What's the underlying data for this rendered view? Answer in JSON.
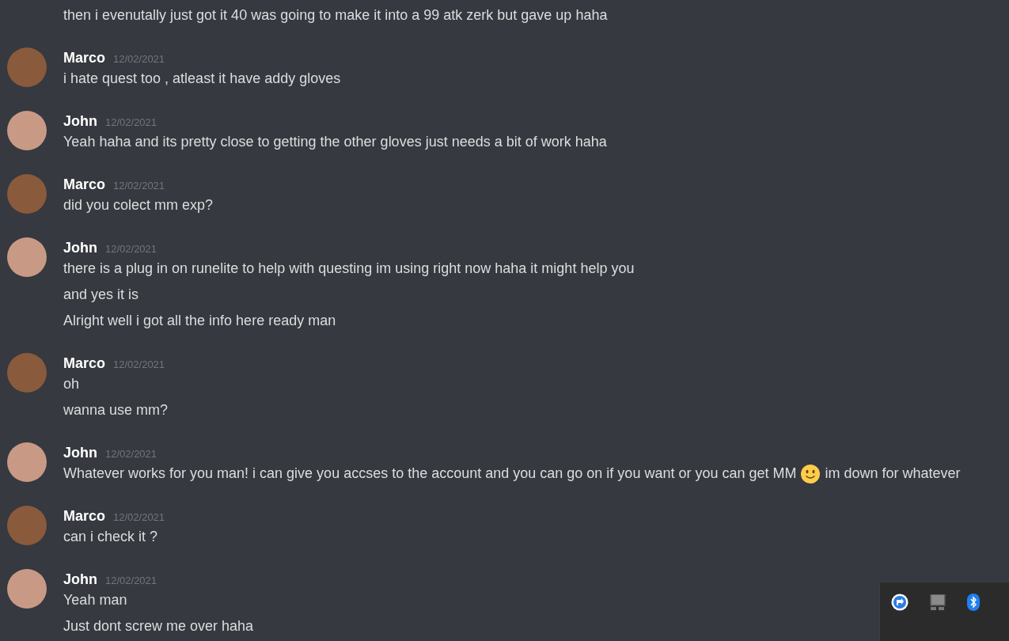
{
  "messages": [
    {
      "lines": [
        {
          "text": "then i evenutally just got it 40 was going to make it into a 99 atk zerk but gave up haha"
        }
      ]
    },
    {
      "author": "Marco",
      "color": "#8a5a3c",
      "timestamp": "12/02/2021",
      "lines": [
        {
          "text": "i hate quest too , atleast it have addy gloves"
        }
      ]
    },
    {
      "author": "John",
      "color": "#c89a86",
      "timestamp": "12/02/2021",
      "lines": [
        {
          "text": "Yeah haha and its pretty close to getting the other gloves just needs a bit of work haha"
        }
      ]
    },
    {
      "author": "Marco",
      "color": "#8a5a3c",
      "timestamp": "12/02/2021",
      "lines": [
        {
          "text": "did you colect mm exp?"
        }
      ]
    },
    {
      "author": "John",
      "color": "#c89a86",
      "timestamp": "12/02/2021",
      "lines": [
        {
          "text": "there is a plug in on runelite to help with questing im using right now haha it might help you"
        },
        {
          "text": "and yes it is"
        },
        {
          "text": "Alright well i got all the info here ready man"
        }
      ]
    },
    {
      "author": "Marco",
      "color": "#8a5a3c",
      "timestamp": "12/02/2021",
      "lines": [
        {
          "text": "oh"
        },
        {
          "text": "wanna use mm?"
        }
      ]
    },
    {
      "author": "John",
      "color": "#c89a86",
      "timestamp": "12/02/2021",
      "lines": [
        {
          "parts": [
            {
              "kind": "text",
              "text": "Whatever works for you man! i can give you accses to the account and you can go on if you want or you can get MM"
            },
            {
              "kind": "emoji"
            },
            {
              "kind": "text",
              "text": "im down for whatever"
            }
          ]
        }
      ]
    },
    {
      "author": "Marco",
      "color": "#8a5a3c",
      "timestamp": "12/02/2021",
      "lines": [
        {
          "text": "can i check it ?"
        }
      ]
    },
    {
      "author": "John",
      "color": "#c89a86",
      "timestamp": "12/02/2021",
      "lines": [
        {
          "text": "Yeah man"
        },
        {
          "text": "Just dont screw me over haha"
        }
      ]
    }
  ]
}
